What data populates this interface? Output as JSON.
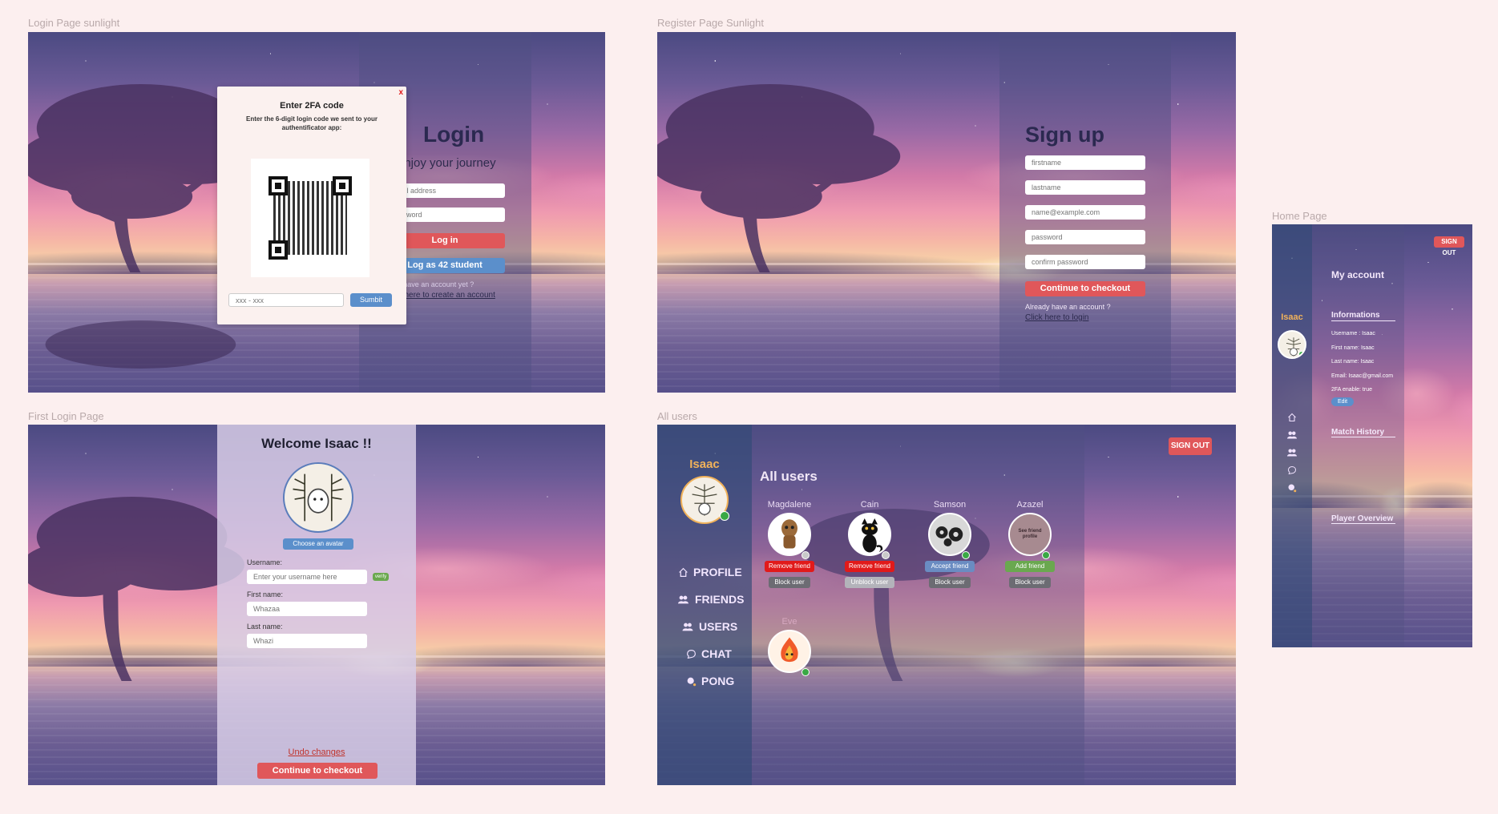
{
  "frames": {
    "login": {
      "label": "Login Page sunlight"
    },
    "register": {
      "label": "Register Page Sunlight"
    },
    "home": {
      "label": "Home Page"
    },
    "first_login": {
      "label": "First Login Page"
    },
    "all_users": {
      "label": "All users"
    }
  },
  "login": {
    "title": "Login",
    "subtitle": "enjoy your journey",
    "email_placeholder": "email address",
    "password_placeholder": "password",
    "login_button": "Log in",
    "student_button": "Log as 42 student",
    "no_account_text": "Don't have an account yet ?",
    "create_account_link": "Click here to create an account",
    "twofa": {
      "close": "x",
      "title": "Enter 2FA code",
      "description": "Enter the 6-digit login code we sent to your authentificator app:",
      "code_placeholder": "xxx - xxx",
      "submit": "Sumbit"
    }
  },
  "register": {
    "title": "Sign up",
    "firstname_placeholder": "firstname",
    "lastname_placeholder": "lastname",
    "email_placeholder": "name@example.com",
    "password_placeholder": "password",
    "confirm_placeholder": "confirm password",
    "continue_button": "Continue to checkout",
    "have_account_text": "Already have an account ?",
    "login_link": "Click here to login"
  },
  "home": {
    "sign_out": "SIGN OUT",
    "username": "Isaac",
    "my_account": "My account",
    "informations_title": "Informations",
    "info_lines": [
      "Username : Isaac",
      "First name: Isaac",
      "Last name: Isaac",
      "Email: Isaac@gmail.com",
      "2FA enable: true"
    ],
    "edit_button": "Edit",
    "match_history": "Match History",
    "player_overview": "Player Overview"
  },
  "first_login": {
    "welcome": "Welcome Isaac !!",
    "choose_avatar": "Choose an avatar",
    "username_label": "Username:",
    "username_placeholder": "Enter your username here",
    "verify_button": "verify",
    "firstname_label": "First name:",
    "firstname_placeholder": "Whazaa",
    "lastname_label": "Last name:",
    "lastname_placeholder": "Whazi",
    "undo_link": "Undo changes",
    "continue_button": "Continue to checkout"
  },
  "all_users": {
    "sign_out": "SIGN OUT",
    "current_user": "Isaac",
    "nav": [
      {
        "label": "PROFILE",
        "icon": "home-icon"
      },
      {
        "label": "FRIENDS",
        "icon": "friends-icon"
      },
      {
        "label": "USERS",
        "icon": "users-icon"
      },
      {
        "label": "CHAT",
        "icon": "chat-icon"
      },
      {
        "label": "PONG",
        "icon": "pong-icon"
      }
    ],
    "title": "All users",
    "users": [
      {
        "name": "Magdalene",
        "action": "Remove friend",
        "block": "Block user",
        "status": "offline"
      },
      {
        "name": "Cain",
        "action": "Remove friend",
        "block": "Block user",
        "status": "offline"
      },
      {
        "name": "Samson",
        "action": "Accept friend",
        "block": "Block user",
        "status": "online"
      },
      {
        "name": "Azazel",
        "action": "Add friend",
        "block": "Block user",
        "status": "online",
        "avatar_text": "See friend profile"
      },
      {
        "name": "Eve",
        "status": "online"
      }
    ],
    "cain_block_label": "Unblock user"
  },
  "colors": {
    "page_bg": "#fcefef",
    "accent_red": "#e0575a",
    "accent_blue": "#5b8fcb",
    "panel_dark": "#3e4a74",
    "online": "#3aa845",
    "offline": "#c9c9c9",
    "remove_red": "#e11a1a",
    "accept_blue": "#6a8cc2",
    "add_green": "#6aa84f",
    "block_grey": "#6c6c73",
    "name_gold": "#f1b25a"
  }
}
